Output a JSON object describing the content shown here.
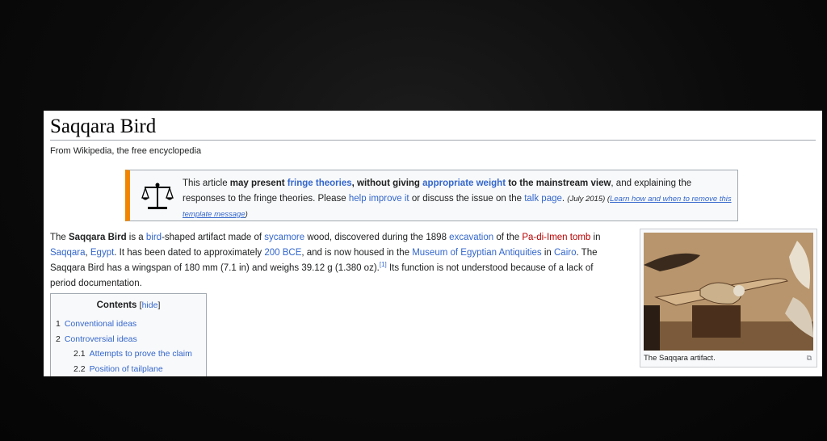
{
  "article": {
    "title": "Saqqara Bird",
    "tagline": "From Wikipedia, the free encyclopedia"
  },
  "notice": {
    "icon": "balance-scale-icon",
    "accent_color": "#f28500",
    "t1": "This article ",
    "t2": "may present ",
    "t3": "fringe theories",
    "t4": ", without giving ",
    "t5": "appropriate weight",
    "t6": " to the mainstream view",
    "t7": ", and explaining the responses to the fringe theories. Please ",
    "t8": "help improve it",
    "t9": " or discuss the issue on the ",
    "t10": "talk page",
    "t11": ". ",
    "t12": "(July 2015)",
    "t13": " (",
    "t14": "Learn how and when to remove this template message",
    "t15": ")"
  },
  "lead": {
    "p1": "The ",
    "p2": "Saqqara Bird",
    "p3": " is a ",
    "p4": "bird",
    "p5": "-shaped artifact made of ",
    "p6": "sycamore",
    "p7": " wood, discovered during the 1898 ",
    "p8": "excavation",
    "p9": " of the ",
    "p10": "Pa-di-Imen tomb",
    "p11": " in ",
    "p12": "Saqqara",
    "p13": ", ",
    "p14": "Egypt",
    "p15": ". It has been dated to approximately ",
    "p16": "200 BCE",
    "p17": ", and is now housed in the ",
    "p18": "Museum of Egyptian Antiquities",
    "p19": " in ",
    "p20": "Cairo",
    "p21": ". The Saqqara Bird has a wingspan of 180 mm (7.1 in) and weighs 39.12 g (1.380 oz).",
    "p22": "[1]",
    "p23": " Its function is not understood because of a lack of period documentation."
  },
  "infobox": {
    "caption": "The Saqqara artifact.",
    "enlarge_icon": "enlarge-icon"
  },
  "toc": {
    "title": "Contents",
    "hide_label": "hide",
    "items": [
      {
        "num": "1",
        "label": "Conventional ideas"
      },
      {
        "num": "2",
        "label": "Controversial ideas"
      },
      {
        "num": "2.1",
        "label": "Attempts to prove the claim"
      },
      {
        "num": "2.2",
        "label": "Position of tailplane"
      }
    ]
  },
  "colors": {
    "link": "#3366cc",
    "redlink": "#ba0000",
    "text": "#202122"
  }
}
